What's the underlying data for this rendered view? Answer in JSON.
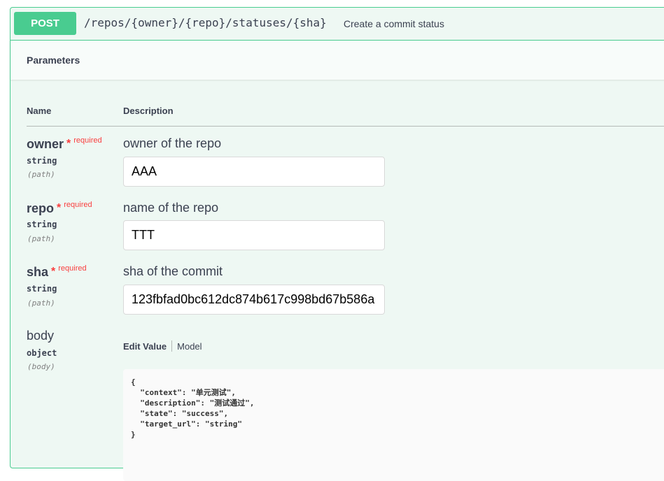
{
  "operation": {
    "method": "POST",
    "path": "/repos/{owner}/{repo}/statuses/{sha}",
    "summary": "Create a commit status"
  },
  "section_title": "Parameters",
  "columns": {
    "name": "Name",
    "description": "Description"
  },
  "params": [
    {
      "name": "owner",
      "required_label": "required",
      "type": "string",
      "in": "(path)",
      "description": "owner of the repo",
      "value": "AAA"
    },
    {
      "name": "repo",
      "required_label": "required",
      "type": "string",
      "in": "(path)",
      "description": "name of the repo",
      "value": "TTT"
    },
    {
      "name": "sha",
      "required_label": "required",
      "type": "string",
      "in": "(path)",
      "description": "sha of the commit",
      "value": "123fbfad0bc612dc874b617c998bd67b586a"
    },
    {
      "name": "body",
      "type": "object",
      "in": "(body)"
    }
  ],
  "body_tabs": {
    "edit": "Edit Value",
    "model": "Model"
  },
  "body_value": "{\n  \"context\": \"单元测试\",\n  \"description\": \"测试通过\",\n  \"state\": \"success\",\n  \"target_url\": \"string\"\n}",
  "colors": {
    "post_green": "#49cc90",
    "required_red": "#f93e3e",
    "block_bg": "#eef8f3"
  }
}
